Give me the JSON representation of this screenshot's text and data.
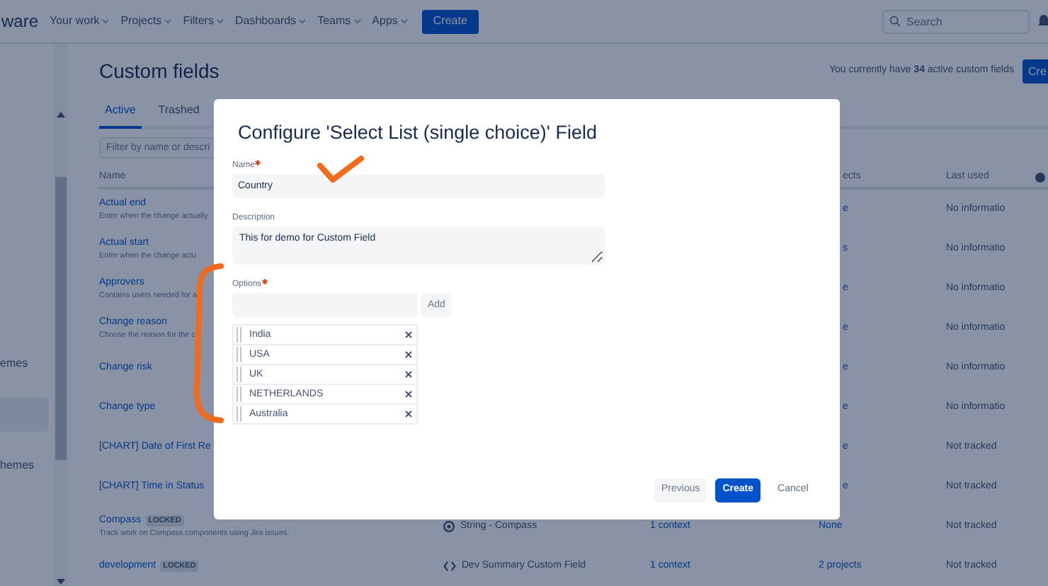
{
  "topbar": {
    "logo": "ware",
    "nav": [
      {
        "label": "Your work"
      },
      {
        "label": "Projects"
      },
      {
        "label": "Filters"
      },
      {
        "label": "Dashboards"
      },
      {
        "label": "Teams"
      },
      {
        "label": "Apps"
      }
    ],
    "create": "Create",
    "search": {
      "placeholder": "Search"
    }
  },
  "sidebar": {
    "items": [
      {
        "label": "emes",
        "selected": false
      },
      {
        "selected": true
      },
      {
        "label": "hemes",
        "selected": false
      }
    ]
  },
  "page": {
    "title": "Custom fields",
    "summary": "You currently have **34** active custom fields",
    "create": "Cre",
    "tabs": [
      {
        "label": "Active",
        "selected": true
      },
      {
        "label": "Trashed",
        "selected": false
      }
    ],
    "filter": {
      "placeholder": "Filter by name or descri"
    }
  },
  "table": {
    "columns": [
      {
        "label": "Name"
      },
      {
        "label": "ects"
      },
      {
        "label": "Last used"
      }
    ],
    "rows": [
      {
        "name": "Actual end",
        "description": "Enter when the change actually",
        "projects": "e",
        "last_used": "No informatio"
      },
      {
        "name": "Actual start",
        "description": "Enter when the change actu",
        "projects": "s",
        "last_used": "No informatio"
      },
      {
        "name": "Approvers",
        "description": "Contains users needed for a",
        "projects": "e",
        "last_used": "No informatio"
      },
      {
        "name": "Change reason",
        "description": "Choose the reason for the c",
        "projects": "e",
        "last_used": "No informatio"
      },
      {
        "name": "Change risk",
        "projects": "e",
        "last_used": "No informatio"
      },
      {
        "name": "Change type",
        "projects": "e",
        "last_used": "No informatio"
      },
      {
        "name": "[CHART] Date of First Re",
        "projects": "e",
        "last_used": "Not tracked"
      },
      {
        "name": "[CHART] Time in Status",
        "projects": "e",
        "last_used": "Not tracked"
      },
      {
        "name": "Compass",
        "locked": "LOCKED",
        "description": "Track work on Compass components using Jira issues.",
        "kind": "compass",
        "type": "String - Compass",
        "contexts": "1 context",
        "projects": "None",
        "last_used": "Not tracked"
      },
      {
        "name": "development",
        "locked": "LOCKED",
        "kind": "code",
        "type": "Dev Summary Custom Field",
        "contexts": "1 context",
        "projects": "2 projects",
        "last_used": "Not tracked"
      }
    ]
  },
  "dialog": {
    "title": "Configure 'Select List (single choice)' Field",
    "fields": [
      {
        "kind": "input",
        "label": "Name",
        "required": true,
        "value": "Country"
      },
      {
        "kind": "textarea",
        "label": "Description",
        "required": false,
        "value": "This for demo for Custom Field"
      }
    ],
    "options": {
      "label": "Options",
      "required": true,
      "add": "Add",
      "items": [
        "India",
        "USA",
        "UK",
        "NETHERLANDS",
        "Australia"
      ]
    },
    "buttons": [
      {
        "label": "Previous",
        "kind": "subtle"
      },
      {
        "label": "Create",
        "kind": "primary"
      },
      {
        "label": "Cancel",
        "kind": "link"
      }
    ]
  }
}
